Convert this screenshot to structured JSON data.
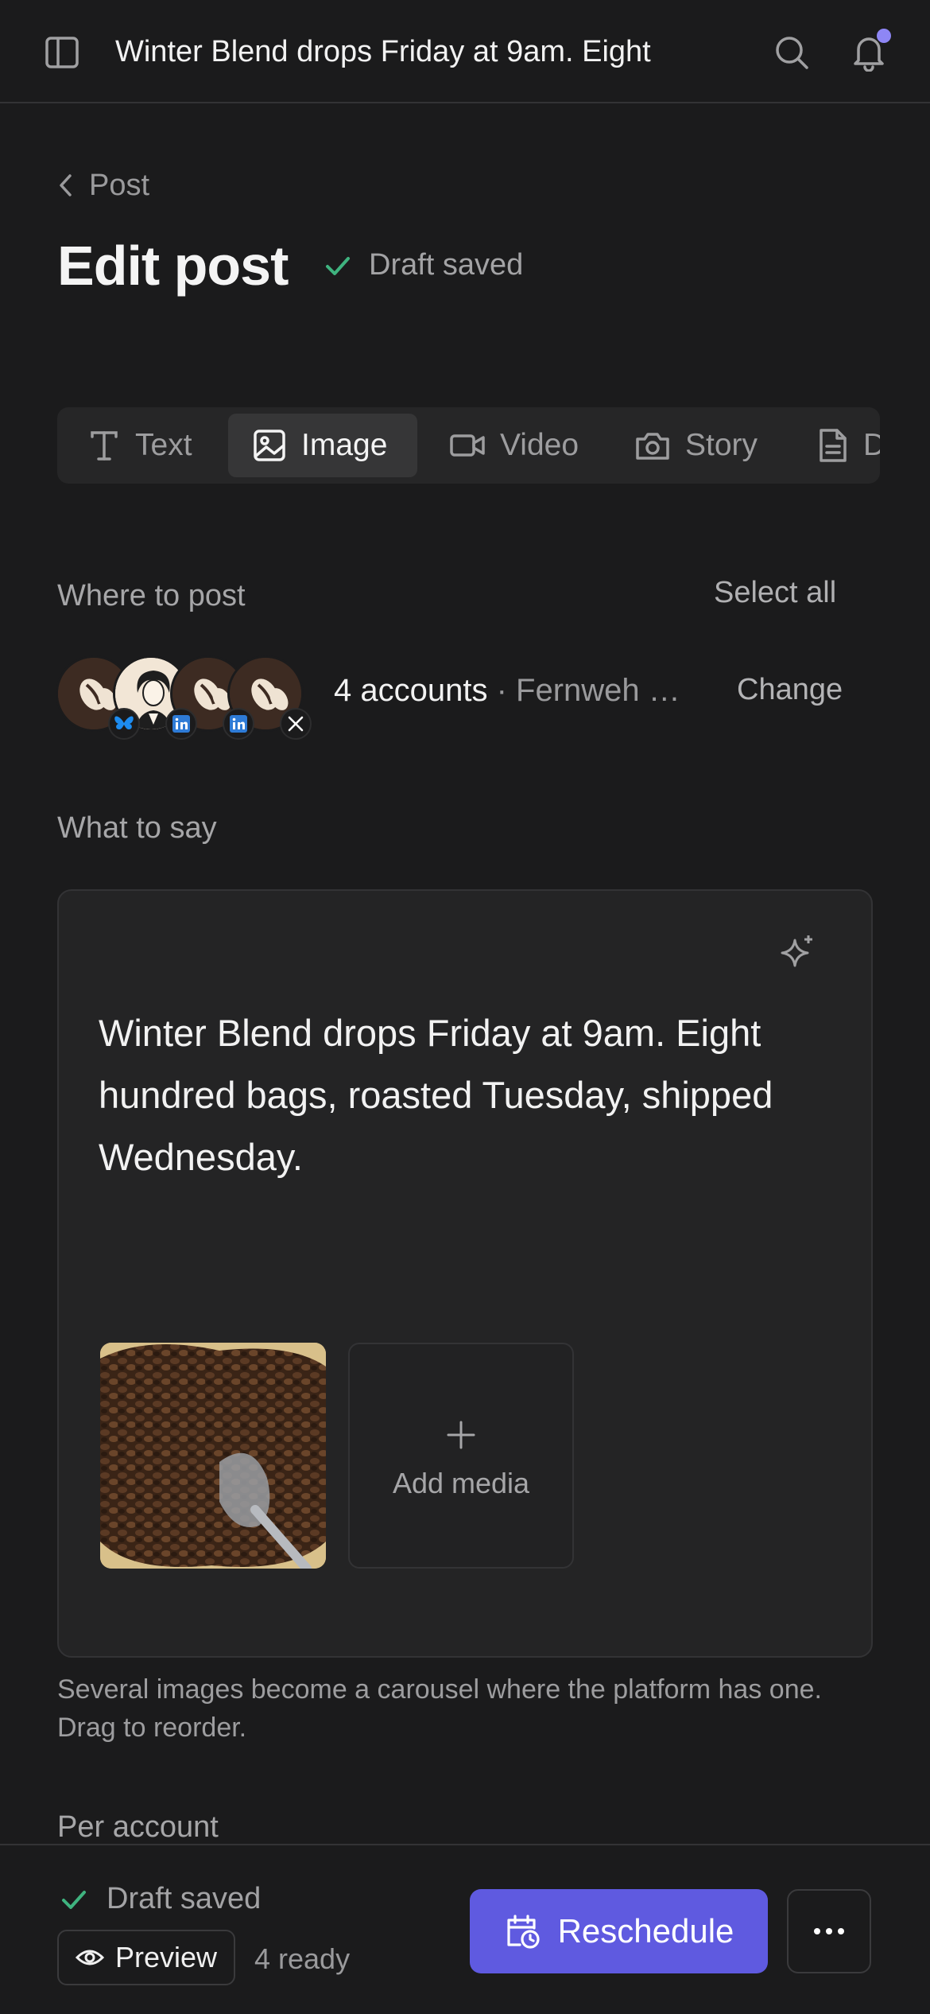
{
  "topbar": {
    "title": "Winter Blend drops Friday at 9am. Eight",
    "has_notification": true
  },
  "header": {
    "back_label": "Post",
    "page_title": "Edit post",
    "draft_status": "Draft saved"
  },
  "tabs": [
    {
      "label": "Text",
      "icon": "text-icon",
      "active": false
    },
    {
      "label": "Image",
      "icon": "image-icon",
      "active": true
    },
    {
      "label": "Video",
      "icon": "video-icon",
      "active": false
    },
    {
      "label": "Story",
      "icon": "camera-icon",
      "active": false
    },
    {
      "label": "D",
      "icon": "document-icon",
      "active": false
    }
  ],
  "where_to_post": {
    "label": "Where to post",
    "select_all": "Select all",
    "accounts_count": "4 accounts",
    "accounts_names": "· Fernweh …",
    "change": "Change",
    "avatars": [
      {
        "icon": "coffee-bean-avatar",
        "badge": "bluesky-icon"
      },
      {
        "icon": "person-illustration-avatar",
        "badge": "linkedin-icon"
      },
      {
        "icon": "coffee-bean-avatar",
        "badge": "linkedin-icon"
      },
      {
        "icon": "coffee-bean-avatar",
        "badge": "x-icon"
      }
    ]
  },
  "what_to_say": {
    "label": "What to say",
    "post_text": "Winter Blend drops Friday at 9am. Eight hundred bags, roasted Tuesday, shipped Wednesday.",
    "add_media": "Add media",
    "hint": "Several images become a carousel where the platform has one. Drag to reorder."
  },
  "per_account": {
    "label": "Per account"
  },
  "bottom_bar": {
    "draft_status": "Draft saved",
    "preview": "Preview",
    "ready": "4 ready",
    "reschedule": "Reschedule"
  },
  "colors": {
    "background": "#1b1b1c",
    "accent": "#5f5ae0",
    "success": "#3fb37f",
    "notification_dot": "#8e86f5"
  }
}
